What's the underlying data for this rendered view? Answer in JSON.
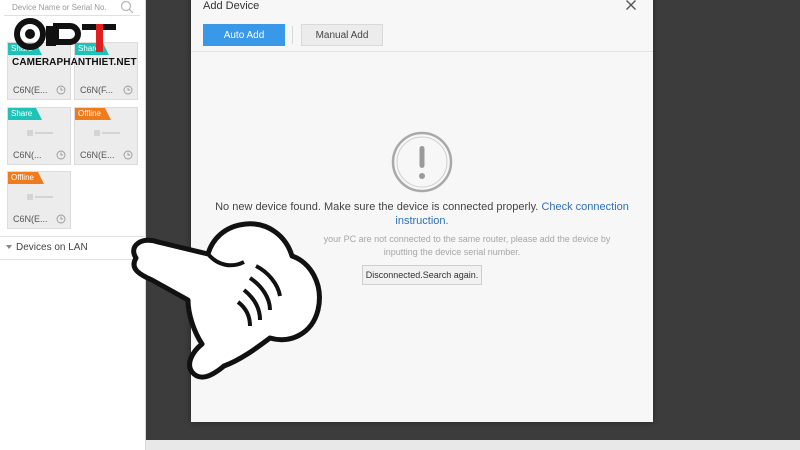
{
  "left_panel": {
    "search_placeholder": "Device Name or Serial No.",
    "logo_text": "CAMERAPHANTHIET.NET",
    "devices": [
      {
        "badge": "Share",
        "badge_type": "share",
        "name": "C6N(E..."
      },
      {
        "badge": "Share",
        "badge_type": "share",
        "name": "C6N(F..."
      },
      {
        "badge": "Share",
        "badge_type": "share",
        "name": "C6N(..."
      },
      {
        "badge": "Offline",
        "badge_type": "offline",
        "name": "C6N(E..."
      },
      {
        "badge": "Offline",
        "badge_type": "offline",
        "name": "C6N(E..."
      }
    ],
    "lan_label": "Devices on LAN"
  },
  "dialog": {
    "title": "Add Device",
    "tabs": {
      "auto": "Auto Add",
      "manual": "Manual Add"
    },
    "message": "No new device found. Make sure the device is connected properly.",
    "link_part1": "Check connection",
    "link_part2": "instruction.",
    "sub_line1": "your PC are not connected to the same router, please add the device by",
    "sub_line2": "inputting the device serial number.",
    "search_button": "Disconnected.Search again."
  },
  "colors": {
    "accent": "#3a98e8",
    "share": "#1ec2b6",
    "offline": "#f07b1d",
    "link": "#2f6fb5"
  }
}
